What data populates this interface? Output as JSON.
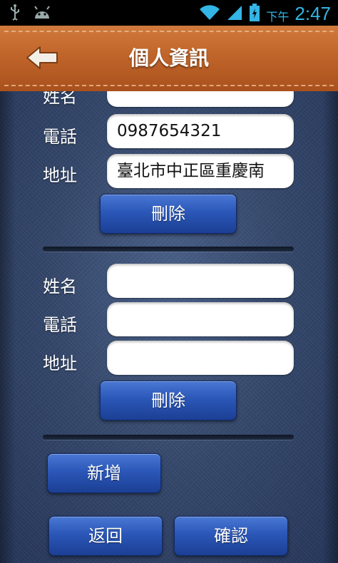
{
  "status_bar": {
    "ampm": "下午",
    "time": "2:47",
    "icons": [
      "usb-icon",
      "android-icon",
      "wifi-icon",
      "signal-icon",
      "battery-icon"
    ]
  },
  "title_bar": {
    "title": "個人資訊",
    "back_icon": "back-arrow-icon"
  },
  "entries": [
    {
      "name_label": "姓名",
      "name_value": "",
      "phone_label": "電話",
      "phone_value": "0987654321",
      "address_label": "地址",
      "address_value": "臺北市中正區重慶南",
      "delete_label": "刪除"
    },
    {
      "name_label": "姓名",
      "name_value": "",
      "phone_label": "電話",
      "phone_value": "",
      "address_label": "地址",
      "address_value": "",
      "delete_label": "刪除"
    }
  ],
  "actions": {
    "add_label": "新增",
    "back_label": "返回",
    "confirm_label": "確認"
  },
  "colors": {
    "status_accent": "#33b5e5",
    "leather": "#c0652a",
    "denim": "#34476a",
    "button_blue": "#2b57b8"
  }
}
